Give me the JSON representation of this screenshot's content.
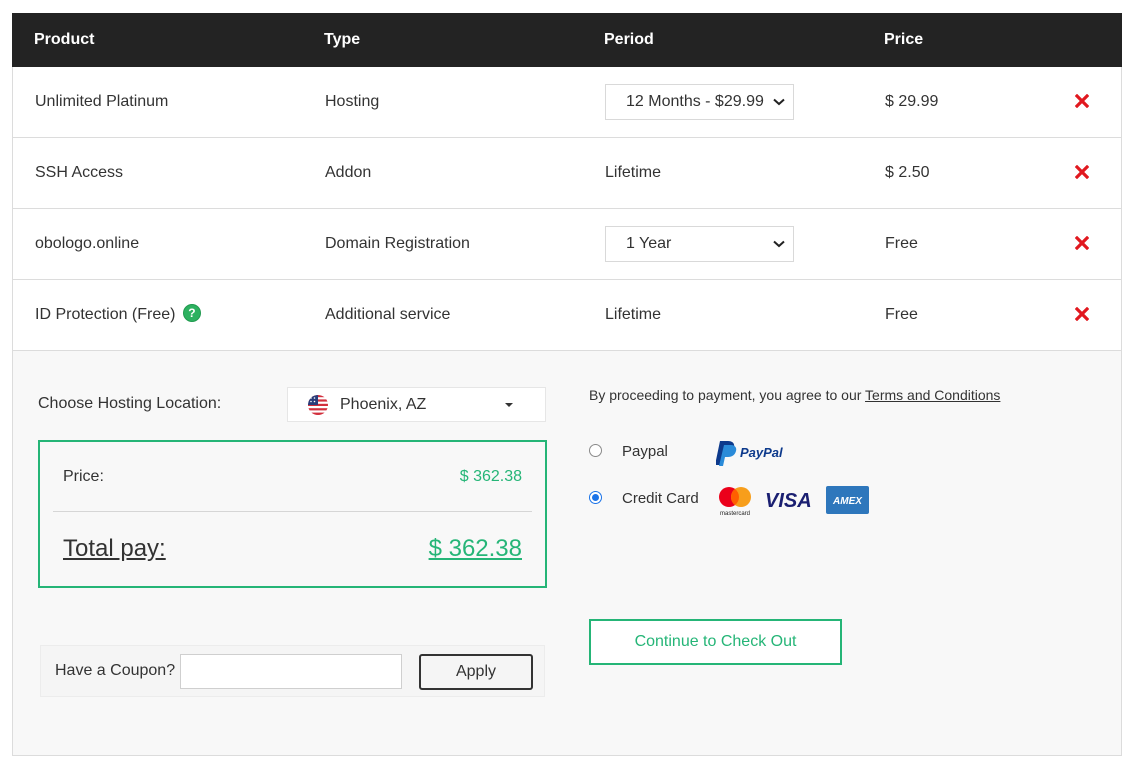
{
  "table": {
    "headers": [
      "Product",
      "Type",
      "Period",
      "Price"
    ],
    "rows": [
      {
        "product": "Unlimited Platinum",
        "type": "Hosting",
        "period_select": "12 Months - $29.99",
        "price": "$ 29.99"
      },
      {
        "product": "SSH Access",
        "type": "Addon",
        "period": "Lifetime",
        "price": "$ 2.50"
      },
      {
        "product": "obologo.online",
        "type": "Domain Registration",
        "period_select": "1 Year",
        "price": "Free"
      },
      {
        "product": "ID Protection (Free)",
        "type": "Additional service",
        "period": "Lifetime",
        "price": "Free"
      }
    ],
    "remove_icon": "close-x-icon",
    "help_icon": "question-icon",
    "remove_color": "#e1181f"
  },
  "location": {
    "label": "Choose Hosting Location:",
    "value": "Phoenix, AZ",
    "flag_icon": "us-flag-icon"
  },
  "summary": {
    "price_label": "Price:",
    "price_value": "$ 362.38",
    "total_label": "Total pay:",
    "total_value": "$ 362.38",
    "accent_color": "#25b577"
  },
  "coupon": {
    "label": "Have a Coupon?",
    "input_value": "",
    "apply_label": "Apply"
  },
  "payment": {
    "terms_prefix": "By proceeding to payment, you agree to our ",
    "terms_link": "Terms and Conditions",
    "options": [
      {
        "label": "Paypal",
        "checked": false,
        "logos": [
          "paypal-logo"
        ]
      },
      {
        "label": "Credit Card",
        "checked": true,
        "logos": [
          "mastercard-logo",
          "visa-logo",
          "amex-logo"
        ]
      }
    ],
    "logo_text": {
      "paypal": "PayPal",
      "mastercard": "mastercard",
      "visa": "VISA",
      "amex": "AMEX"
    },
    "checkout_label": "Continue to Check Out"
  }
}
